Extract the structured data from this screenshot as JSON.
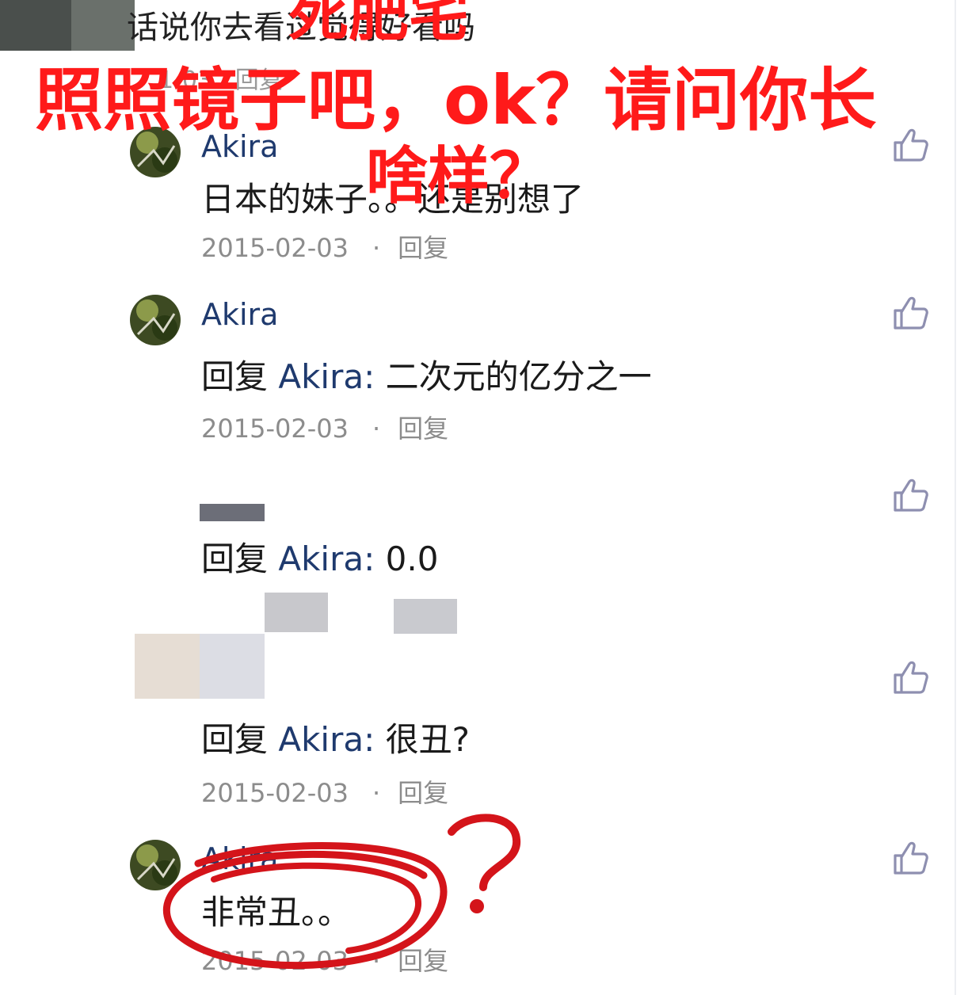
{
  "top_comment": {
    "text": "话说你去看过觉得好看吗",
    "meta_partial": "1-03 · 回复"
  },
  "overlay": {
    "line1_partial": "死肥宅",
    "line2": "照照镜子吧，ok？请问你长",
    "line3": "啥样？",
    "color": "#ff1a1a"
  },
  "comments": [
    {
      "username": "Akira",
      "text": "日本的妹子。。还是别想了",
      "date": "2015-02-03",
      "dot": "·",
      "reply_label": "回复"
    },
    {
      "username": "Akira",
      "reply_prefix": "回复",
      "mention": "Akira:",
      "text": "二次元的亿分之一",
      "date": "2015-02-03",
      "dot": "·",
      "reply_label": "回复"
    },
    {
      "username": "",
      "reply_prefix": "回复",
      "mention": "Akira:",
      "text": "0.0",
      "date": "",
      "reply_label": "回复"
    },
    {
      "username": "",
      "reply_prefix": "回复",
      "mention": "Akira:",
      "text": "很丑?",
      "date": "2015-02-03",
      "dot": "·",
      "reply_label": "回复"
    },
    {
      "username": "Akira",
      "text": "非常丑。。",
      "date": "2015-02-03",
      "dot": "·",
      "reply_label": "回复"
    }
  ],
  "icons": {
    "like": "thumbs-up-icon",
    "avatar": "avatar-image"
  },
  "colors": {
    "username": "#1f3a6e",
    "meta": "#8c8c8c",
    "like_icon": "#8e8fb0",
    "annotation": "#d4141a"
  }
}
